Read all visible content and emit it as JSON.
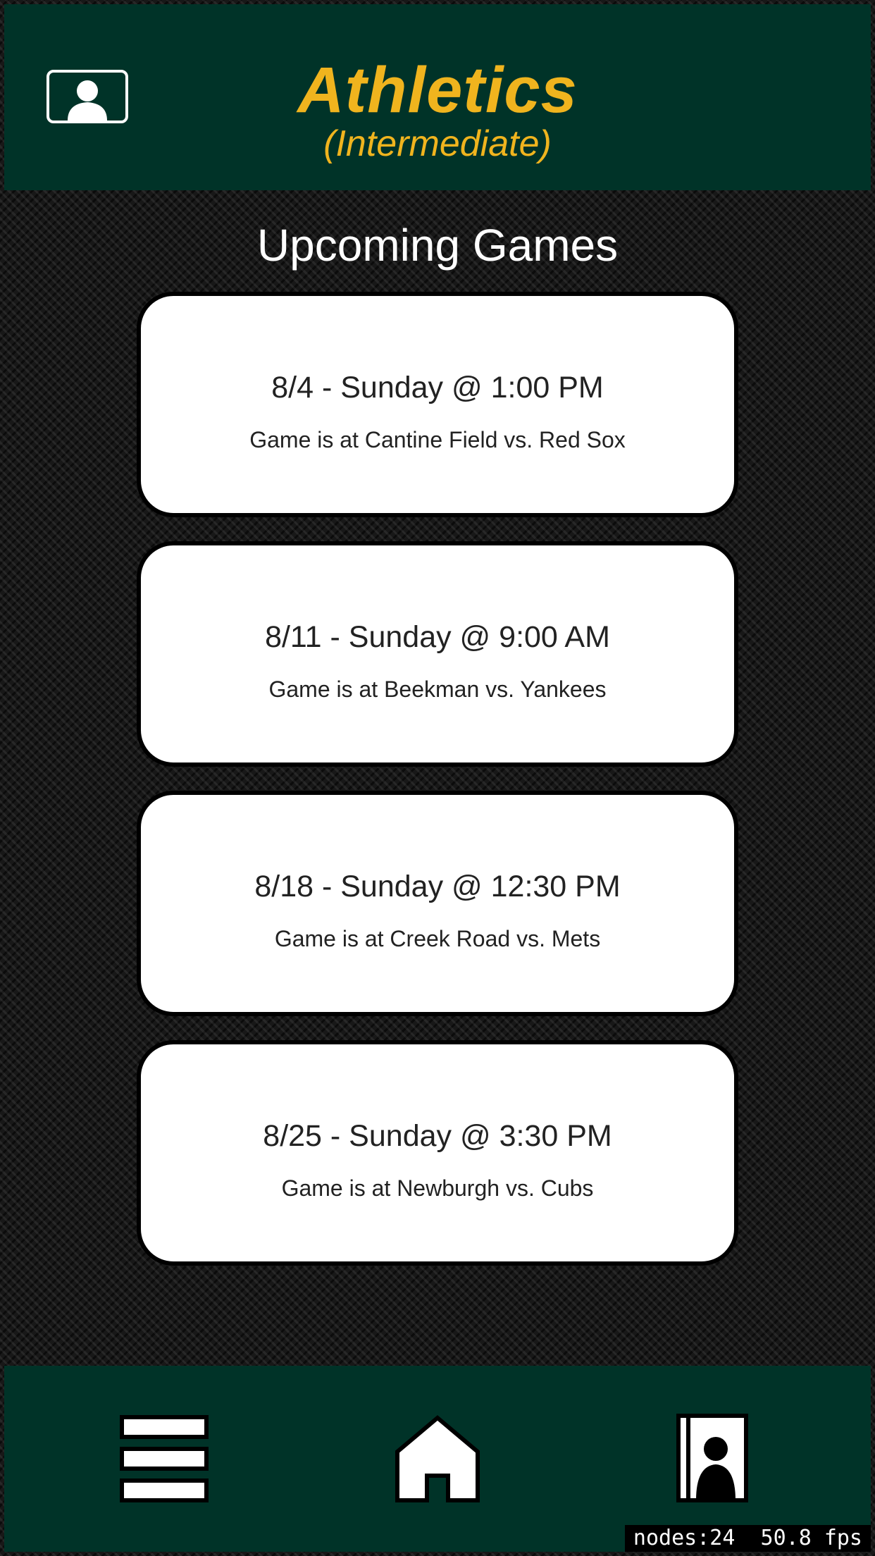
{
  "header": {
    "team_name": "Athletics",
    "division": "(Intermediate)",
    "profile_icon": "person-card-icon"
  },
  "main": {
    "section_title": "Upcoming Games",
    "games": [
      {
        "when": "8/4 - Sunday @ 1:00 PM",
        "where": "Game is at Cantine Field vs. Red Sox"
      },
      {
        "when": "8/11 - Sunday @ 9:00 AM",
        "where": "Game is at Beekman vs. Yankees"
      },
      {
        "when": "8/18 - Sunday @ 12:30 PM",
        "where": "Game is at Creek Road vs. Mets"
      },
      {
        "when": "8/25 - Sunday @ 3:30 PM",
        "where": "Game is at Newburgh vs. Cubs"
      }
    ]
  },
  "footer": {
    "items": [
      {
        "icon": "menu-icon"
      },
      {
        "icon": "home-icon"
      },
      {
        "icon": "roster-icon"
      }
    ]
  },
  "debug": {
    "stats": "nodes:24  50.8 fps"
  },
  "colors": {
    "header_bg": "#003328",
    "accent": "#f0b41e",
    "card_bg": "#ffffff"
  }
}
